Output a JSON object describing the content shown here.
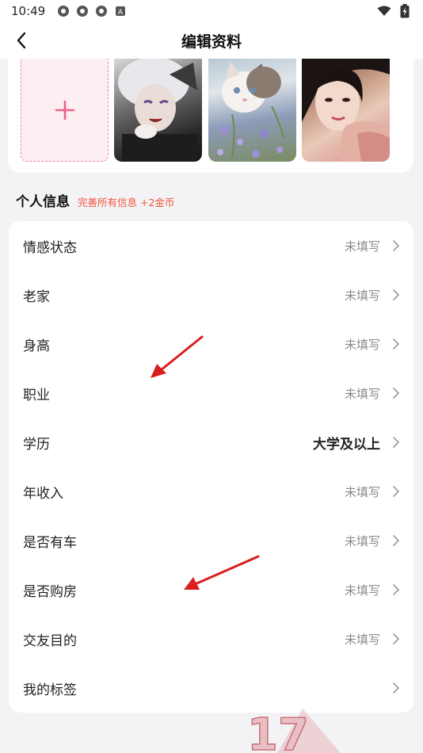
{
  "status_bar": {
    "time": "10:49",
    "battery_glyph": "battery-charging-icon",
    "left_icons": [
      "app-icon-1",
      "app-icon-2",
      "app-icon-3",
      "keyboard-a-icon"
    ],
    "right_icons": [
      "wifi-icon",
      "battery-icon"
    ]
  },
  "nav": {
    "title": "编辑资料",
    "back_icon": "chevron-left-icon"
  },
  "photos": {
    "add_icon": "plus-icon"
  },
  "section": {
    "title": "个人信息",
    "hint": "完善所有信息 +2金币"
  },
  "info_rows": [
    {
      "label": "情感状态",
      "value": "未填写",
      "filled": false
    },
    {
      "label": "老家",
      "value": "未填写",
      "filled": false
    },
    {
      "label": "身高",
      "value": "未填写",
      "filled": false
    },
    {
      "label": "职业",
      "value": "未填写",
      "filled": false
    },
    {
      "label": "学历",
      "value": "大学及以上",
      "filled": true
    },
    {
      "label": "年收入",
      "value": "未填写",
      "filled": false
    },
    {
      "label": "是否有车",
      "value": "未填写",
      "filled": false
    },
    {
      "label": "是否购房",
      "value": "未填写",
      "filled": false
    },
    {
      "label": "交友目的",
      "value": "未填写",
      "filled": false
    },
    {
      "label": "我的标签",
      "value": "",
      "filled": false
    }
  ],
  "watermark": {
    "text": "17"
  },
  "colors": {
    "accent": "#f0543c",
    "pink": "#f08aa5",
    "annotation_red": "#d81e1e"
  }
}
